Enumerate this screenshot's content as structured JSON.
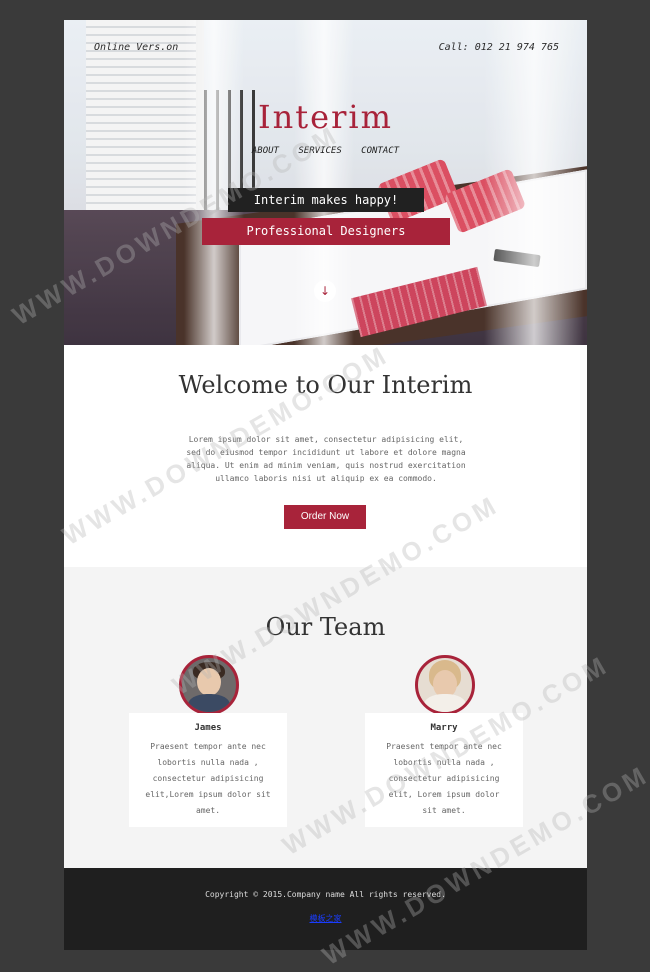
{
  "header": {
    "online_version": "Online Vers.on",
    "phone": "Call: 012 21 974 765",
    "brand": "Interim",
    "nav": [
      "ABOUT",
      "SERVICES",
      "CONTACT"
    ],
    "tagline_1": "Interim makes happy!",
    "tagline_2": "Professional Designers",
    "scroll_icon": "arrow-down-icon"
  },
  "welcome": {
    "title": "Welcome to Our Interim",
    "body": "Lorem ipsum dolor sit amet, consectetur adipisicing elit, sed do eiusmod tempor incididunt ut labore et dolore magna aliqua. Ut enim ad minim veniam, quis nostrud exercitation ullamco laboris nisi ut aliquip ex ea commodo.",
    "button": "Order Now"
  },
  "team": {
    "title": "Our Team",
    "members": [
      {
        "name": "James",
        "bio": "Praesent tempor ante nec lobortis nulla nada , consectetur adipisicing elit,Lorem ipsum dolor sit amet."
      },
      {
        "name": "Marry",
        "bio": "Praesent tempor ante nec lobortis nulla nada , consectetur adipisicing elit, Lorem ipsum dolor sit amet."
      }
    ]
  },
  "footer": {
    "copyright": "Copyright © 2015.Company name All rights reserved.",
    "link": "模板之家"
  },
  "watermarks": [
    "WWW.DOWNDEMO.COM"
  ],
  "colors": {
    "accent": "#a8233a",
    "dark": "#212121",
    "footer": "#1f1f1f",
    "background": "#3a3a3a"
  }
}
